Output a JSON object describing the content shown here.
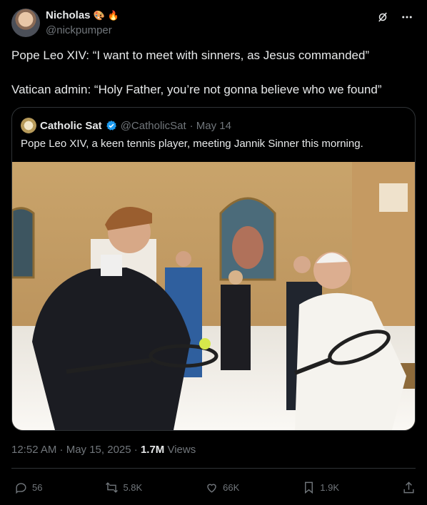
{
  "author": {
    "name": "Nicholas",
    "handle": "@nickpumper",
    "name_emojis": [
      "🎨",
      "🔥"
    ]
  },
  "tweet": {
    "line1": "Pope Leo XIV: “I want to meet with sinners, as Jesus commanded”",
    "line2": "Vatican admin: “Holy Father, you’re not gonna believe who we found”"
  },
  "quote": {
    "name": "Catholic Sat",
    "handle": "@CatholicSat",
    "date": "· May 14",
    "text": "Pope Leo XIV, a keen tennis player, meeting Jannik Sinner this morning.",
    "image_icon": "photo-image"
  },
  "meta": {
    "timestamp": "12:52 AM · May 15, 2025 · ",
    "views_count": "1.7M",
    "views_label": " Views"
  },
  "actions": {
    "replies": "56",
    "reposts": "5.8K",
    "likes": "66K",
    "bookmarks": "1.9K"
  },
  "colors": {
    "background": "#000000",
    "text": "#e7e9ea",
    "muted": "#71767b",
    "border": "#2f3336",
    "verified": "#1d9bf0"
  }
}
